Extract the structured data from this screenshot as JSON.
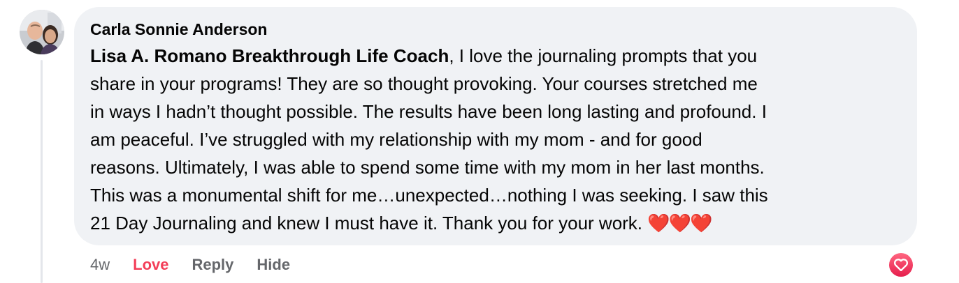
{
  "comment": {
    "author": "Carla Sonnie Anderson",
    "mention": "Lisa A. Romano Breakthrough Life Coach",
    "text_lines": [
      ", I love the journaling prompts that you",
      "share in your programs! They are so thought provoking. Your courses stretched me",
      "in ways I hadn’t thought possible. The results have been long lasting and profound. I",
      "am peaceful. I’ve struggled with my relationship with my mom - and for good",
      "reasons. Ultimately, I was able to spend some time with my mom in her last months.",
      "This was a monumental shift for me…unexpected…nothing I was seeking. I saw this",
      "21 Day Journaling and knew I must have it. Thank you for your work. "
    ],
    "emoji": "❤️❤️❤️"
  },
  "actions": {
    "timestamp": "4w",
    "love_label": "Love",
    "reply_label": "Reply",
    "hide_label": "Hide"
  },
  "reaction": {
    "icon": "heart-reaction-icon",
    "color": "#f33e58"
  },
  "colors": {
    "bubble": "#f0f2f5",
    "text": "#050505",
    "secondary": "#65676b",
    "love": "#f33e58"
  }
}
